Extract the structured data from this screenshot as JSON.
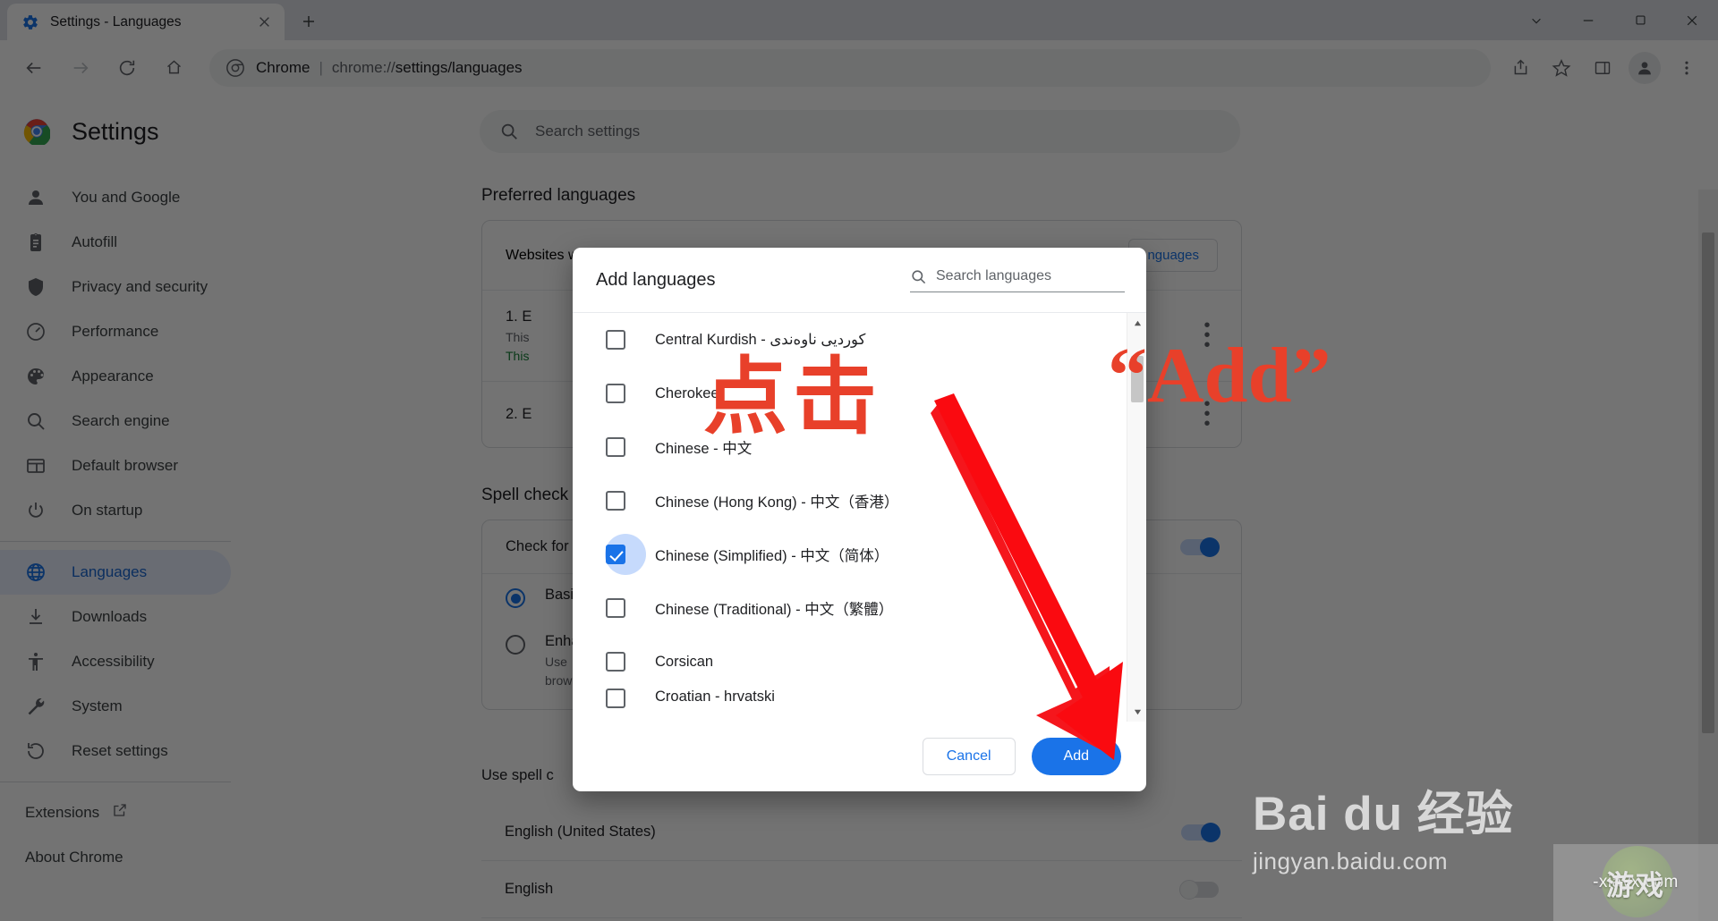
{
  "browser": {
    "tab": {
      "title": "Settings - Languages",
      "favicon_icon": "gear-icon",
      "close_icon": "close-icon"
    },
    "new_tab_icon": "plus-icon",
    "window_controls": {
      "minimize": "minimize-icon",
      "maximize": "maximize-icon",
      "close": "close-icon",
      "tab_search": "chevron-down-icon"
    },
    "nav": {
      "back_icon": "arrow-back-icon",
      "forward_icon": "arrow-forward-icon",
      "reload_icon": "reload-icon",
      "home_icon": "home-icon"
    },
    "omnibox": {
      "site_icon": "chrome-icon",
      "site_label": "Chrome",
      "separator": "|",
      "url_prefix": "chrome://",
      "url_bold": "settings/languages"
    },
    "toolbar_icons": [
      "share-icon",
      "star-icon",
      "side-panel-icon",
      "profile-avatar-icon",
      "three-dot-menu-icon"
    ]
  },
  "settings": {
    "brand_title": "Settings",
    "brand_logo_icon": "chrome-logo-icon",
    "search": {
      "icon": "search-icon",
      "placeholder": "Search settings"
    },
    "sidebar": {
      "items": [
        {
          "label": "You and Google",
          "icon": "person-icon",
          "active": false
        },
        {
          "label": "Autofill",
          "icon": "clipboard-icon",
          "active": false
        },
        {
          "label": "Privacy and security",
          "icon": "shield-icon",
          "active": false
        },
        {
          "label": "Performance",
          "icon": "speedometer-icon",
          "active": false
        },
        {
          "label": "Appearance",
          "icon": "palette-icon",
          "active": false
        },
        {
          "label": "Search engine",
          "icon": "search-icon",
          "active": false
        },
        {
          "label": "Default browser",
          "icon": "browser-window-icon",
          "active": false
        },
        {
          "label": "On startup",
          "icon": "power-icon",
          "active": false
        },
        {
          "label": "Languages",
          "icon": "globe-icon",
          "active": true
        },
        {
          "label": "Downloads",
          "icon": "download-icon",
          "active": false
        },
        {
          "label": "Accessibility",
          "icon": "accessibility-icon",
          "active": false
        },
        {
          "label": "System",
          "icon": "wrench-icon",
          "active": false
        },
        {
          "label": "Reset settings",
          "icon": "restore-icon",
          "active": false
        }
      ],
      "footer_items": [
        {
          "label": "Extensions",
          "icon": "external-link-icon"
        },
        {
          "label": "About Chrome",
          "icon": "info-icon"
        }
      ]
    },
    "preferred_languages": {
      "section_title": "Preferred languages",
      "header_row_label": "Websites w",
      "add_languages_button": "nguages",
      "rows": [
        {
          "title": "1. E",
          "sub1": "This",
          "sub2": "This",
          "menu_icon": "three-dot-menu-icon"
        },
        {
          "title": "2. E",
          "sub1": "",
          "sub2": "",
          "menu_icon": "three-dot-menu-icon"
        }
      ]
    },
    "spell_check": {
      "section_title": "Spell check",
      "check_label": "Check for s",
      "options": [
        {
          "label": "Basi",
          "selected": true
        },
        {
          "label": "Enha",
          "selected": false,
          "sub1": "Use",
          "sub2": "brow"
        }
      ],
      "use_spell_check_label": "Use spell c",
      "language_toggles": [
        {
          "label": "English (United States)",
          "on": true
        },
        {
          "label": "English",
          "on": false
        }
      ]
    }
  },
  "dialog": {
    "title": "Add languages",
    "search": {
      "icon": "search-icon",
      "placeholder": "Search languages"
    },
    "languages": [
      {
        "label": "Central Kurdish - کوردیی ناوەندی",
        "checked": false
      },
      {
        "label": "Cherokee",
        "checked": false
      },
      {
        "label": "Chinese - 中文",
        "checked": false
      },
      {
        "label": "Chinese (Hong Kong) - 中文（香港）",
        "checked": false
      },
      {
        "label": "Chinese (Simplified) - 中文（简体）",
        "checked": true
      },
      {
        "label": "Chinese (Traditional) - 中文（繁體）",
        "checked": false
      },
      {
        "label": "Corsican",
        "checked": false
      },
      {
        "label": "Croatian - hrvatski",
        "checked": false
      }
    ],
    "scrollbar": {
      "up_icon": "triangle-up-icon",
      "down_icon": "triangle-down-icon"
    },
    "cancel_label": "Cancel",
    "add_label": "Add"
  },
  "annotations": {
    "click_text": "点击",
    "add_quote_text": "“Add”",
    "arrow_icon": "red-arrow-icon",
    "accent_color": "#e8402a"
  },
  "watermarks": {
    "baidu_line1": "Bai du 经验",
    "baidu_line2": "jingyan.baidu.com",
    "site_text": "-xiayx.com",
    "site_text_cn": "游戏"
  }
}
